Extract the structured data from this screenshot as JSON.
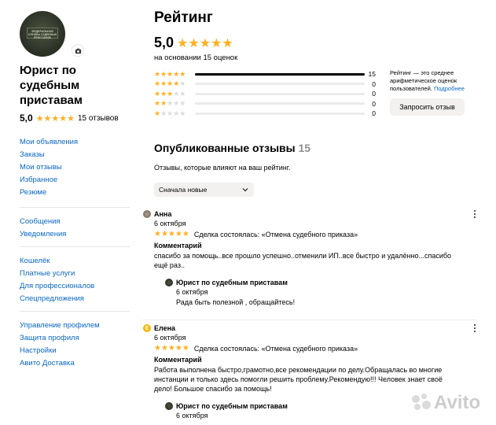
{
  "seller": {
    "name": "Юрист по судебным приставам",
    "avatar_patch_text": "ФЕДЕРАЛЬНАЯ СЛУЖБА СУДЕБНЫХ ПРИСТАВОВ",
    "score": "5,0",
    "stars": "★★★★★",
    "reviews_count": "15 отзывов"
  },
  "nav": {
    "group1": [
      "Мои объявления",
      "Заказы",
      "Мои отзывы",
      "Избранное",
      "Резюме"
    ],
    "group2": [
      "Сообщения",
      "Уведомления"
    ],
    "group3": [
      "Кошелёк",
      "Платные услуги",
      "Для профессионалов",
      "Спецпредложения"
    ],
    "group4": [
      "Управление профилем",
      "Защита профиля",
      "Настройки",
      "Авито Доставка"
    ]
  },
  "rating": {
    "title": "Рейтинг",
    "score": "5,0",
    "stars": "★★★★★",
    "basis": "на основании 15 оценок",
    "breakdown": [
      {
        "stars": "★★★★★",
        "grey": "",
        "count": "15",
        "fraction": 1.0
      },
      {
        "stars": "★★★★",
        "grey": "★",
        "count": "0",
        "fraction": 0
      },
      {
        "stars": "★★★",
        "grey": "★★",
        "count": "0",
        "fraction": 0
      },
      {
        "stars": "★★",
        "grey": "★★★",
        "count": "0",
        "fraction": 0
      },
      {
        "stars": "★",
        "grey": "★★★★",
        "count": "0",
        "fraction": 0
      }
    ],
    "note": "Рейтинг — это среднее арифметическое оценок пользователей.",
    "note_link": "Подробнее",
    "request_button": "Запросить отзыв"
  },
  "published": {
    "title": "Опубликованные отзывы",
    "count": "15",
    "subtitle": "Отзывы, которые влияют на ваш рейтинг.",
    "sort_value": "Сначала новые"
  },
  "reviews": [
    {
      "author": "Анна",
      "avatar_color": "#8d8070",
      "date": "6 октября",
      "stars": "★★★★★",
      "deal": "Сделка состоялась: «Отмена судебного приказа»",
      "comment_label": "Комментарий",
      "text": "спасибо за помощь..все прошло успешно..отменили ИП..все быстро и удалённо...спасибо ещё раз..",
      "reply": {
        "author": "Юрист по судебным приставам",
        "date": "6 октября",
        "text": "Рада быть полезной , обращайтесь!"
      }
    },
    {
      "author": "Елена",
      "avatar_letter": "Е",
      "avatar_color": "#f5b800",
      "date": "6 октября",
      "stars": "★★★★★",
      "deal": "Сделка состоялась: «Отмена судебного приказа»",
      "comment_label": "Комментарий",
      "text": "Работа выполнена быстро,грамотно,все рекомендации по делу.Обращалась во многие инстанции и только здесь помогли решить проблему.Рекомендую!!! Человек знает своё дело! Большое спасибо за помощь!",
      "reply": {
        "author": "Юрист по судебным приставам",
        "date": "6 октября"
      }
    }
  ],
  "watermark": "Avito"
}
